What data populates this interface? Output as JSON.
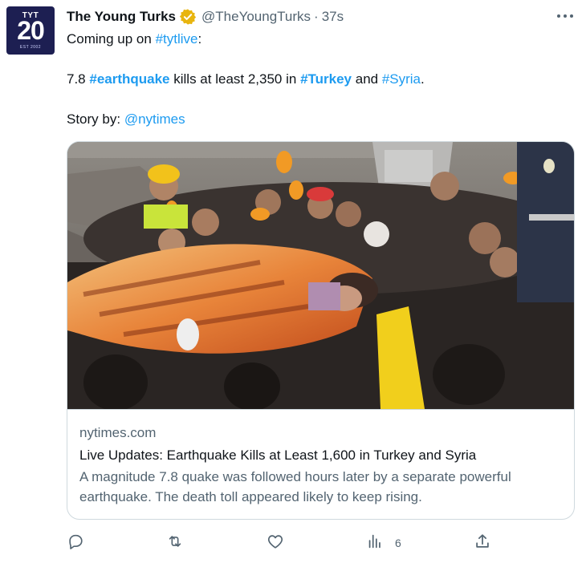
{
  "account": {
    "display_name": "The Young Turks",
    "handle": "@TheYoungTurks",
    "separator": "·",
    "timestamp": "37s",
    "avatar": {
      "top_text": "TYT",
      "number": "20",
      "bottom_text": "EST 2002"
    },
    "verified_badge_color": "#e8b50f"
  },
  "tweet": {
    "line1": {
      "prefix": "Coming up on ",
      "hashtag": "#tytlive",
      "suffix": ":"
    },
    "line2": {
      "part1": "7.8 ",
      "tag1": "#earthquake",
      "part2": " kills at least 2,350 in ",
      "tag2": "#Turkey",
      "part3": " and ",
      "tag3": "#Syria",
      "part4": "."
    },
    "line3": {
      "prefix": "Story by: ",
      "mention": "@nytimes"
    }
  },
  "card": {
    "domain": "nytimes.com",
    "title": "Live Updates: Earthquake Kills at Least 1,600 in Turkey and Syria",
    "description": "A magnitude 7.8 quake was followed hours later by a separate powerful earthquake. The death toll appeared likely to keep rising."
  },
  "actions": {
    "reply_icon": "reply-icon",
    "retweet_icon": "retweet-icon",
    "like_icon": "heart-icon",
    "views_icon": "views-chart-icon",
    "views_count": "6",
    "share_icon": "share-icon"
  },
  "colors": {
    "link": "#1d9bf0",
    "secondary_text": "#536471",
    "border": "#cfd9de"
  }
}
